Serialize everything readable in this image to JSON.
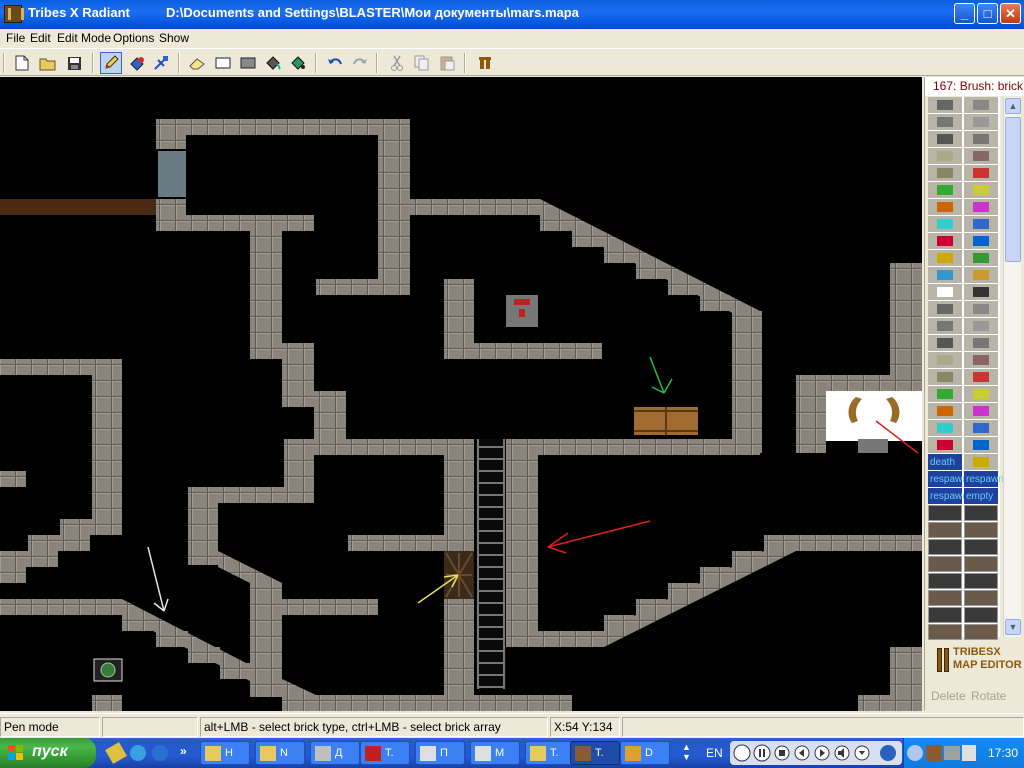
{
  "window": {
    "app_name": "Tribes X Radiant",
    "file_path": "D:\\Documents and Settings\\BLASTER\\Мои документы\\mars.mapa",
    "btn_minimize": "_",
    "btn_maximize": "□",
    "btn_close": "✕"
  },
  "menu": {
    "items": [
      "File",
      "Edit",
      "Edit Mode",
      "Options",
      "Show"
    ]
  },
  "toolbar": {
    "icons": [
      "new-file-icon",
      "open-folder-icon",
      "save-icon",
      "pen-icon",
      "fill-icon",
      "pick-icon",
      "eraser-icon",
      "rectangle-icon",
      "filled-rectangle-icon",
      "bucket-icon",
      "bucket-color-icon",
      "undo-icon",
      "redo-icon",
      "cut-icon",
      "copy-icon",
      "paste-icon",
      "pause-icon"
    ],
    "active": "pen-icon"
  },
  "palette": {
    "header": "167: Brush: brick",
    "tile_labels": [
      "death",
      "respawn",
      "respawn",
      "respawn",
      "empty"
    ],
    "logo_line1": "TRIBESX",
    "logo_line2": "MAP EDITOR",
    "delete_label": "Delete",
    "rotate_label": "Rotate",
    "scroll_up": "▲",
    "scroll_down": "▼"
  },
  "statusbar": {
    "mode": "Pen mode",
    "hint": "alt+LMB - select brick type, ctrl+LMB - select brick array",
    "coords": "X:54 Y:134"
  },
  "taskbar": {
    "start_label": "пуск",
    "chevron": "»",
    "tasks": [
      {
        "label": "Н",
        "icon": "folder-icon"
      },
      {
        "label": "N",
        "icon": "folder-icon"
      },
      {
        "label": "Д",
        "icon": "program-icon"
      },
      {
        "label": "Т.",
        "icon": "game-icon"
      },
      {
        "label": "П",
        "icon": "window-icon"
      },
      {
        "label": "М",
        "icon": "window-icon"
      },
      {
        "label": "Т.",
        "icon": "folder-icon"
      },
      {
        "label": "Т.",
        "icon": "tribes-icon"
      },
      {
        "label": "D",
        "icon": "app-icon"
      }
    ],
    "active_task": 7,
    "language": "EN",
    "clock": "17:30"
  },
  "colors": {
    "brick": "#8a857c",
    "brick_light": "#a39e93",
    "brick_dark": "#5e5a53",
    "canvas": "#000000",
    "title_bar": "#0a5fe0"
  }
}
